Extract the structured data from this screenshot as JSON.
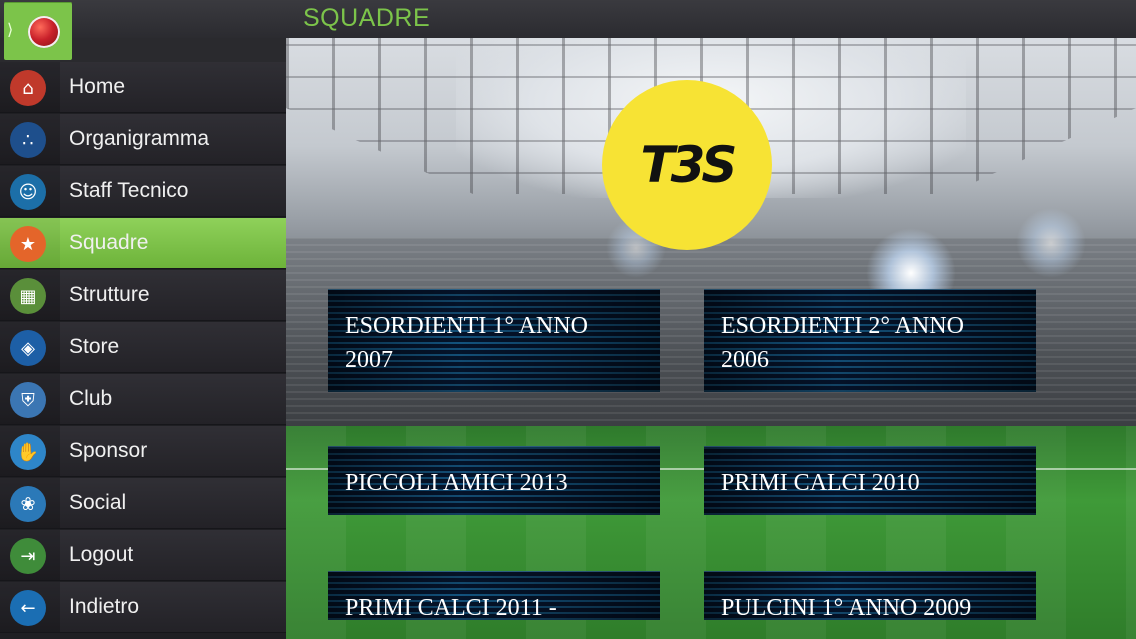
{
  "header": {
    "title": "SQUADRE",
    "menu_toggle_glyph": "⟩"
  },
  "sidebar": {
    "items": [
      {
        "label": "Home",
        "icon": "home-icon",
        "glyph": "⌂",
        "color": "#c0392b"
      },
      {
        "label": "Organigramma",
        "icon": "org-chart-icon",
        "glyph": "∴",
        "color": "#1e4f8c"
      },
      {
        "label": "Staff Tecnico",
        "icon": "coach-icon",
        "glyph": "☺",
        "color": "#1c6fa8"
      },
      {
        "label": "Squadre",
        "icon": "player-icon",
        "glyph": "★",
        "color": "#e4652a",
        "active": true
      },
      {
        "label": "Strutture",
        "icon": "field-icon",
        "glyph": "▦",
        "color": "#5a8f3a"
      },
      {
        "label": "Store",
        "icon": "store-icon",
        "glyph": "◈",
        "color": "#1d5fa6"
      },
      {
        "label": "Club",
        "icon": "shield-icon",
        "glyph": "⛨",
        "color": "#3b76b3"
      },
      {
        "label": "Sponsor",
        "icon": "handshake-icon",
        "glyph": "✋",
        "color": "#2e86c9"
      },
      {
        "label": "Social",
        "icon": "social-icon",
        "glyph": "❀",
        "color": "#2b79b8"
      },
      {
        "label": "Logout",
        "icon": "door-exit-icon",
        "glyph": "⇥",
        "color": "#3f8c3a"
      },
      {
        "label": "Indietro",
        "icon": "back-arrow-icon",
        "glyph": "←",
        "color": "#1b6eb3"
      }
    ]
  },
  "main": {
    "logo_text": "T3S",
    "teams": [
      {
        "label": "ESORDIENTI 1° ANNO\n2007"
      },
      {
        "label": "ESORDIENTI 2° ANNO\n2006"
      },
      {
        "label": "PICCOLI AMICI 2013"
      },
      {
        "label": "PRIMI CALCI 2010"
      },
      {
        "label": "PRIMI CALCI 2011 -"
      },
      {
        "label": "PULCINI 1° ANNO 2009"
      }
    ]
  },
  "colors": {
    "accent_green": "#7cc44a",
    "logo_yellow": "#f7e334"
  }
}
